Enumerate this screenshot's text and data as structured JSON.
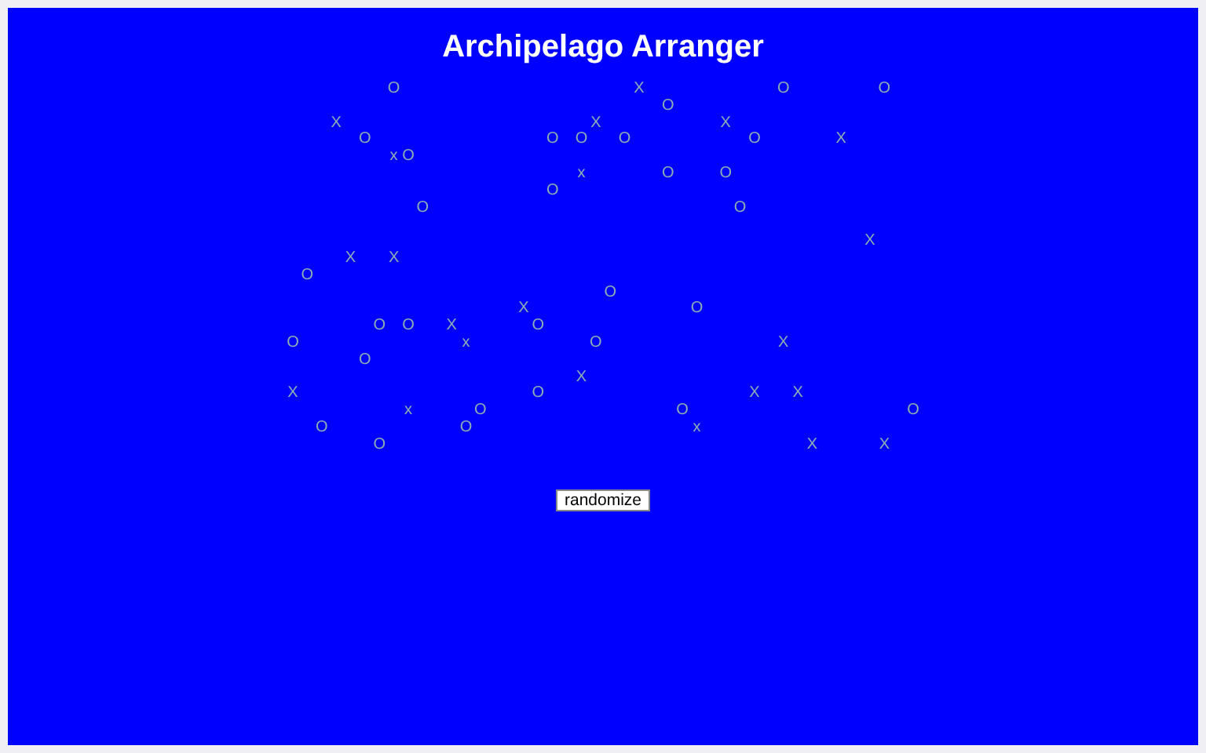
{
  "title": "Archipelago Arranger",
  "marks": [
    "O",
    "X",
    "O",
    "O",
    "O",
    "X",
    "X",
    "X",
    "O",
    "O",
    "O",
    "O",
    "O",
    "X",
    "x",
    "O",
    "x",
    "O",
    "O",
    "O",
    "O",
    "O",
    "X",
    "X",
    "X",
    "O",
    "O",
    "X",
    "O",
    "O",
    "O",
    "X",
    "O",
    "O",
    "x",
    "O",
    "X",
    "O",
    "X",
    "X",
    "O",
    "X",
    "X",
    "x",
    "O",
    "O",
    "O",
    "O",
    "O",
    "x",
    "O",
    "X",
    "X"
  ],
  "button": "randomize"
}
